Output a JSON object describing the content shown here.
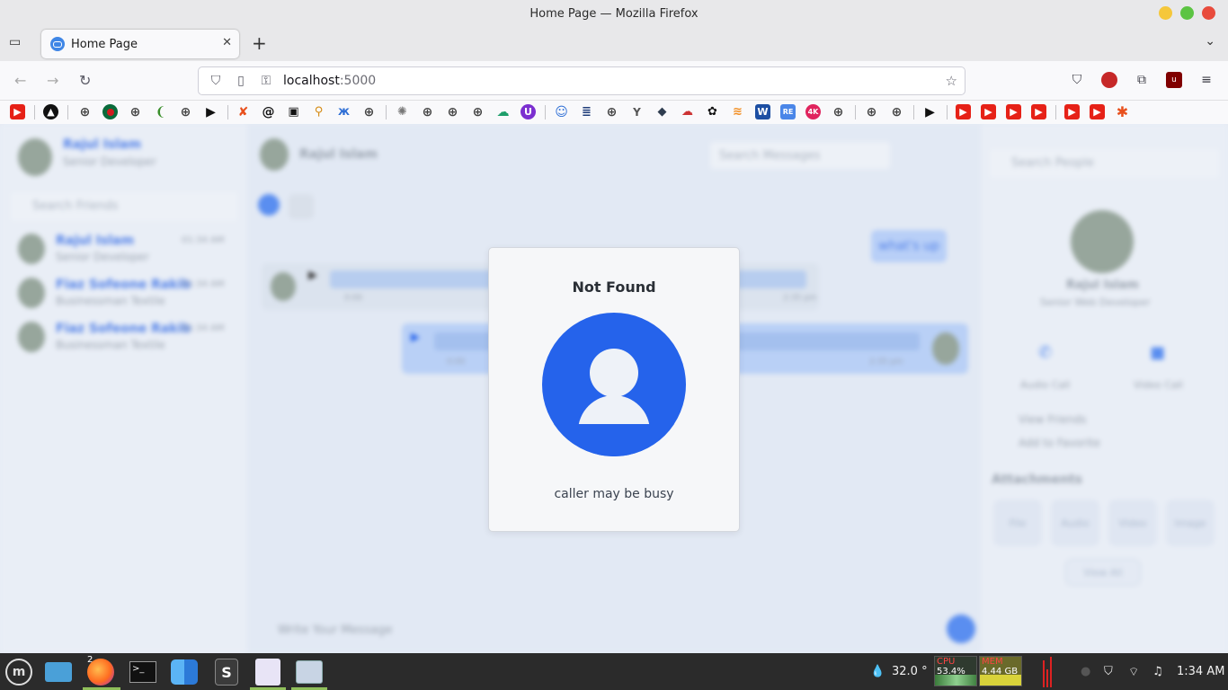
{
  "window": {
    "title": "Home Page — Mozilla Firefox"
  },
  "tab": {
    "title": "Home Page"
  },
  "url": {
    "host": "localhost",
    "port": ":5000"
  },
  "app": {
    "left": {
      "user_name": "Rajul Islam",
      "user_role": "Senior Developer",
      "search_placeholder": "Search Friends",
      "friends": [
        {
          "name": "Rajul Islam",
          "sub": "Senior Developer",
          "time": "01:34 AM"
        },
        {
          "name": "Fiaz Sofeone Rakib",
          "sub": "Businessman Textile",
          "time": "01:34 AM"
        },
        {
          "name": "Fiaz Sofeone Rakib",
          "sub": "Businessman Textile",
          "time": "01:34 AM"
        }
      ]
    },
    "middle": {
      "chat_name": "Rajul Islam",
      "search_placeholder": "Search Messages",
      "bubble": "what's up",
      "audio1_time": "0:00",
      "audio1_stamp": "2:35 pm",
      "audio2_time": "0:00",
      "audio2_stamp": "2:35 pm",
      "input_placeholder": "Write Your Message"
    },
    "right": {
      "search_placeholder": "Search People",
      "profile_name": "Rajul Islam",
      "profile_role": "Senior Web Developer",
      "audio_call": "Audio Call",
      "video_call": "Video Call",
      "view_friends": "View Friends",
      "add_favorite": "Add to Favorite",
      "attachments": "Attachments",
      "attach_types": [
        "File",
        "Audio",
        "Video",
        "Image"
      ],
      "view_all": "View All"
    }
  },
  "modal": {
    "title": "Not Found",
    "message": "caller may be busy"
  },
  "taskbar": {
    "firefox_badge": "2",
    "temperature": "32.0 °",
    "cpu_label": "CPU",
    "cpu_value": "53.4%",
    "mem_label": "MEM",
    "mem_value": "4.44 GB",
    "clock": "1:34 AM"
  },
  "colors": {
    "accent": "#2563eb",
    "taskbar_bg": "#2b2b2b",
    "win_min": "#f5c73b",
    "win_max": "#5cc443",
    "win_close": "#e84b3c"
  }
}
